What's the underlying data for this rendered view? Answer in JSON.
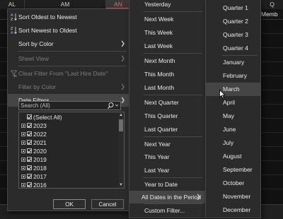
{
  "sheet": {
    "columns": [
      {
        "label": "AL",
        "selected": false
      },
      {
        "label": "AM",
        "selected": false
      },
      {
        "label": "AN",
        "selected": true
      },
      {
        "label": "Q",
        "selected": false
      }
    ],
    "header_fragment": "Memb"
  },
  "filter_menu": {
    "items": [
      {
        "label": "Sort Oldest to Newest",
        "disabled": false,
        "submenu": false
      },
      {
        "label": "Sort Newest to Oldest",
        "disabled": false,
        "submenu": false
      },
      {
        "label": "Sort by Color",
        "disabled": false,
        "submenu": true
      },
      {
        "label": "Sheet View",
        "disabled": true,
        "submenu": true
      },
      {
        "label": "Clear Filter From \"Last Hire Date\"",
        "disabled": true,
        "submenu": false
      },
      {
        "label": "Filter by Color",
        "disabled": true,
        "submenu": true
      },
      {
        "label": "Date Filters",
        "disabled": false,
        "submenu": true,
        "highlighted": true
      }
    ],
    "search_placeholder": "Search (All)",
    "tree": [
      {
        "label": "(Select All)",
        "checked": true,
        "expandable": false
      },
      {
        "label": "2023",
        "checked": true,
        "expandable": true
      },
      {
        "label": "2022",
        "checked": true,
        "expandable": true
      },
      {
        "label": "2021",
        "checked": true,
        "expandable": true
      },
      {
        "label": "2020",
        "checked": true,
        "expandable": true
      },
      {
        "label": "2019",
        "checked": true,
        "expandable": true
      },
      {
        "label": "2018",
        "checked": true,
        "expandable": true
      },
      {
        "label": "2017",
        "checked": true,
        "expandable": true
      },
      {
        "label": "2016",
        "checked": true,
        "expandable": true
      }
    ],
    "ok_label": "OK",
    "cancel_label": "Cancel"
  },
  "date_menu": {
    "items": [
      "Yesterday",
      "Next Week",
      "This Week",
      "Last Week",
      "Next Month",
      "This Month",
      "Last Month",
      "Next Quarter",
      "This Quarter",
      "Last Quarter",
      "Next Year",
      "This Year",
      "Last Year",
      "Year to Date",
      "All Dates in the Period",
      "Custom Filter..."
    ],
    "highlighted": "All Dates in the Period"
  },
  "period_menu": {
    "items": [
      "Quarter 1",
      "Quarter 2",
      "Quarter 3",
      "Quarter 4",
      "January",
      "February",
      "March",
      "April",
      "May",
      "June",
      "July",
      "August",
      "September",
      "October",
      "November",
      "December"
    ],
    "highlighted": "March"
  },
  "icons": {
    "sort_asc": "sort-ascending-icon",
    "sort_desc": "sort-descending-icon",
    "clear_filter": "clear-filter-icon",
    "search": "search-icon",
    "submenu": "chevron-right-icon",
    "cursor": "mouse-pointer-icon"
  },
  "colors": {
    "menu_bg": "#2b2b2b",
    "highlight": "#454545",
    "selected_column_accent": "#d85757",
    "disabled_text": "#7e7e7e"
  }
}
